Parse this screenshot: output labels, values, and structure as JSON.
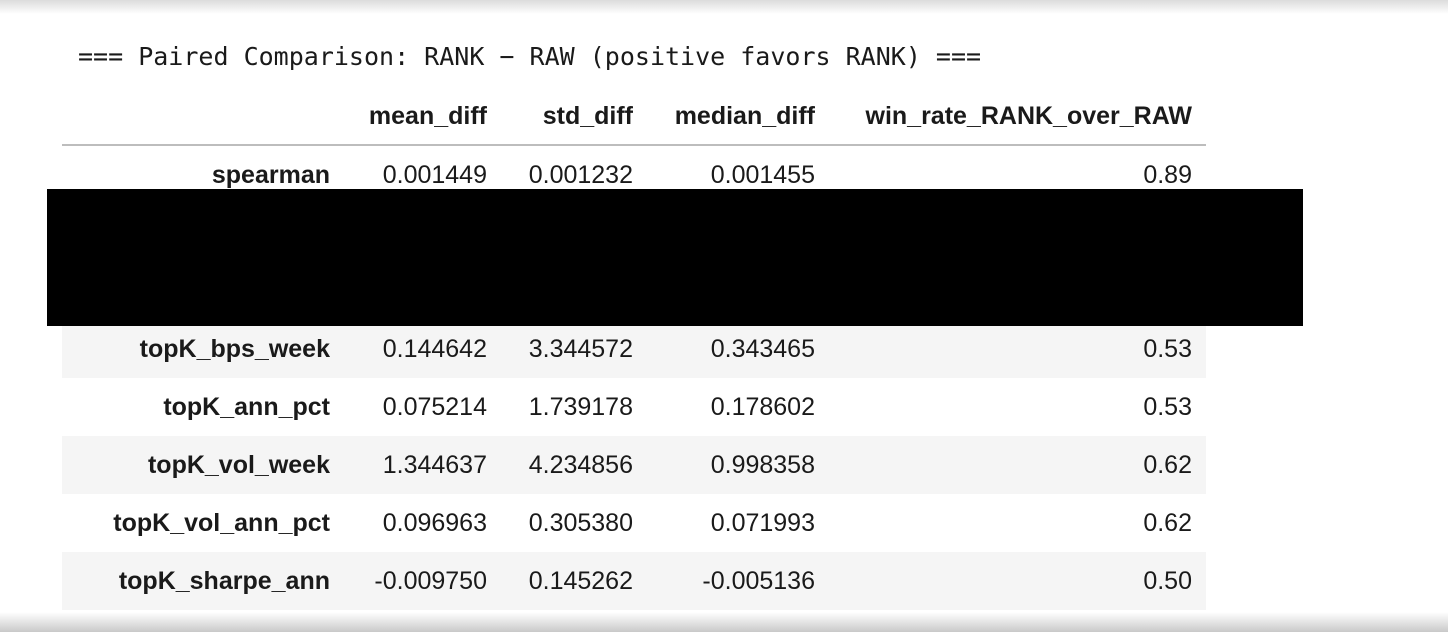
{
  "output": {
    "header_text": "=== Paired Comparison: RANK − RAW (positive favors RANK) ==="
  },
  "table": {
    "columns": [
      "mean_diff",
      "std_diff",
      "median_diff",
      "win_rate_RANK_over_RAW"
    ],
    "rows": [
      {
        "label": "spearman",
        "values": [
          "0.001449",
          "0.001232",
          "0.001455",
          "0.89"
        ]
      },
      {
        "label": "",
        "values": [
          "",
          "",
          "",
          ""
        ]
      },
      {
        "label": "",
        "values": [
          "",
          "",
          "",
          ""
        ]
      },
      {
        "label": "topK_bps_week",
        "values": [
          "0.144642",
          "3.344572",
          "0.343465",
          "0.53"
        ]
      },
      {
        "label": "topK_ann_pct",
        "values": [
          "0.075214",
          "1.739178",
          "0.178602",
          "0.53"
        ]
      },
      {
        "label": "topK_vol_week",
        "values": [
          "1.344637",
          "4.234856",
          "0.998358",
          "0.62"
        ]
      },
      {
        "label": "topK_vol_ann_pct",
        "values": [
          "0.096963",
          "0.305380",
          "0.071993",
          "0.62"
        ]
      },
      {
        "label": "topK_sharpe_ann",
        "values": [
          "-0.009750",
          "0.145262",
          "-0.005136",
          "0.50"
        ]
      }
    ]
  },
  "colors": {
    "striped_row": "#f5f5f5",
    "header_rule": "#bdbdbd",
    "redaction": "#000000"
  }
}
